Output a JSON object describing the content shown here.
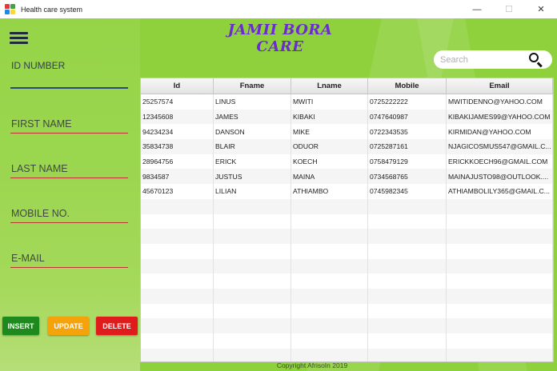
{
  "window": {
    "title": "Health care system",
    "controls": {
      "minimize": "—",
      "maximize": "☐",
      "close": "✕"
    }
  },
  "app_title": "JAMII BORA CARE",
  "form": {
    "id_label": "ID NUMBER",
    "first_name_label": "FIRST NAME",
    "last_name_label": "LAST NAME",
    "mobile_label": "MOBILE NO.",
    "email_label": "E-MAIL"
  },
  "buttons": {
    "insert": "INSERT",
    "update": "UPDATE",
    "delete": "DELETE"
  },
  "colors": {
    "insert": "#1e8a1e",
    "update": "#f4a30a",
    "delete": "#e01b1b",
    "title": "#6a2bd1",
    "background": "#8ed13c"
  },
  "search": {
    "placeholder": "Search"
  },
  "table": {
    "columns": [
      "Id",
      "Fname",
      "Lname",
      "Mobile",
      "Email"
    ],
    "rows": [
      [
        "25257574",
        "LINUS",
        "MWITI",
        "0725222222",
        "MWITIDENNO@YAHOO.COM"
      ],
      [
        "12345608",
        "JAMES",
        "KIBAKI",
        "0747640987",
        "KIBAKIJAMES99@YAHOO.COM"
      ],
      [
        "94234234",
        "DANSON",
        "MIKE",
        "0722343535",
        "KIRMIDAN@YAHOO.COM"
      ],
      [
        "35834738",
        "BLAIR",
        "ODUOR",
        "0725287161",
        "NJAGICOSMUS547@GMAIL.C..."
      ],
      [
        "28964756",
        "ERICK",
        "KOECH",
        "0758479129",
        "ERICKKOECH96@GMAIL.COM"
      ],
      [
        "9834587",
        "JUSTUS",
        "MAINA",
        "0734568765",
        "MAINAJUSTO98@OUTLOOK...."
      ],
      [
        "45670123",
        "LILIAN",
        "ATHIAMBO",
        "0745982345",
        "ATHIAMBOLILY365@GMAIL.C..."
      ]
    ]
  },
  "footer": "Copyright AfrisoIn 2019"
}
